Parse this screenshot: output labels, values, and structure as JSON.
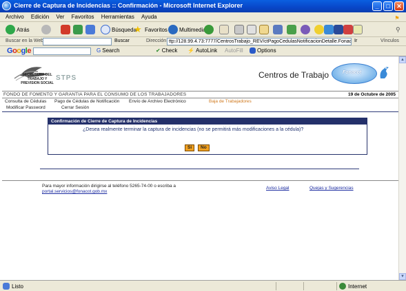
{
  "window": {
    "title": "Cierre de Captura de Incidencias :: Confirmación - Microsoft Internet Explorer",
    "minimize": "_",
    "maximize": "□",
    "close": "✕"
  },
  "menu": [
    "Archivo",
    "Edición",
    "Ver",
    "Favoritos",
    "Herramientas",
    "Ayuda"
  ],
  "toolbar": {
    "back_label": "Atrás",
    "search_label": "Búsqueda",
    "favorites_label": "Favoritos",
    "multimedia_label": "Multimedia"
  },
  "address": {
    "search_web_label": "Buscar en la Web",
    "search_button": "Buscar",
    "address_label": "Dirección",
    "url": "ttp://128.99.4.73:7777/CentrosTrabajo_REV/ctPagoCedulasNotificacionDetalle.Fonacot",
    "go_label": "Ir",
    "links_label": "Vínculos"
  },
  "google_bar": {
    "logo": "Google",
    "search_label": "Search",
    "check_label": "Check",
    "autolink_label": "AutoLink",
    "autofill_label": "AutoFill",
    "options_label": "Options"
  },
  "site": {
    "stps_text": "SECRETARIA DEL TRABAJO Y PREVISION SOCIAL",
    "stps_acronym": "STPS",
    "title": "Centros de Trabajo",
    "fonacot_logo": "Fonacot",
    "org_name": "FONDO DE FOMENTO Y GARANTIA PARA EL CONSUMO DE LOS TRABAJADORES",
    "date": "19 de Octubre de 2005"
  },
  "nav": {
    "row1": [
      "Consulta de Cédulas",
      "Pago de Cédulas de Notificación",
      "Envío de Archivo Electrónico",
      "Baja de Trabajadores"
    ],
    "row2": [
      "Modificar Password",
      "Cerrar Sesión"
    ]
  },
  "dialog": {
    "title": "Confirmación de Cierre de Captura de Incidencias",
    "message": "¿Desea realmente terminar la captura de incidencias (no se permitirá más modificaciones a la cédula)?",
    "yes": "Sí",
    "no": "No"
  },
  "footer": {
    "info": "Para mayor información dirigirse al teléfono 5265-74-00 o escriba a",
    "email": "portal.servicios@fonacot.gob.mx",
    "legal": "Aviso Legal",
    "complaints": "Quejas y Sugerencias"
  },
  "status": {
    "text": "Listo",
    "zone": "Internet"
  },
  "colors": {
    "nav_active": "#d07a20",
    "dialog_header": "#24306a",
    "button": "#f0a020",
    "xp_title": "#0846c8"
  }
}
